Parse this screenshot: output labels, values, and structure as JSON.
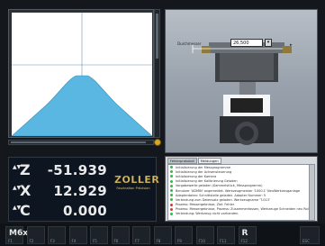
{
  "tool": {
    "label": "Durchmesser",
    "value": "26,500",
    "spin": "▾",
    "spin2": "▸"
  },
  "dro": {
    "axes": [
      {
        "arrows": "▲▼",
        "letter": "Z",
        "value": "-51.939"
      },
      {
        "arrows": "▲▼",
        "letter": "X",
        "value": "12.929"
      },
      {
        "arrows": "▲▼",
        "letter": "C",
        "value": "0.000"
      }
    ],
    "brand": {
      "name": "ZOLLER",
      "slogan": "Faszination Präzision"
    }
  },
  "messages": {
    "tabs": [
      "Fehlerprotokoll",
      "Meldungen"
    ],
    "items": [
      {
        "text": "Initialisierung der Messprogramme",
        "color": "#3bb54a"
      },
      {
        "text": "Initialisierung der Achsensteuerung",
        "color": "#3bb54a"
      },
      {
        "text": "Initialisierung der Kamera",
        "color": "#3bb54a"
      },
      {
        "text": "Initialisierung der Kalibrierung Geladen",
        "color": "#3bb54a"
      },
      {
        "text": "Vorgabewerte geladen (Sammelstück, Messprogramm)",
        "color": "#3bb54a"
      },
      {
        "text": "Benutzer 'ADMIN' angemeldet. Werkzeugmeister '1000.1' NeuWerkzeuganlage",
        "color": "#3bb54a"
      },
      {
        "text": "Adapterdaten: Schnittstelle geladen. Adapter Nummer: 5",
        "color": "#3bb54a"
      },
      {
        "text": "Verbindung zum Datensatz geladen. Werkzeugname 'T-013'",
        "color": "#3bb54a"
      },
      {
        "text": "Prozess: Messergebnisse, Ziel: Fehler",
        "color": "#d23b3b"
      },
      {
        "text": "Prozess: Messergebnisse, Prozess: Zusammenfassen, Werkzeuge Schneiden neu Rollen",
        "color": "#d23b3b"
      },
      {
        "text": "Verbindung: Werkzeug nicht vorhanden.",
        "color": "#3bb54a"
      }
    ]
  },
  "fkeys": [
    {
      "label": "F1",
      "icon": "M6x"
    },
    {
      "label": "F2",
      "icon": ""
    },
    {
      "label": "F3",
      "icon": ""
    },
    {
      "label": "F4",
      "icon": ""
    },
    {
      "label": "F5",
      "icon": ""
    },
    {
      "label": "F6",
      "icon": ""
    },
    {
      "label": "F7",
      "icon": ""
    },
    {
      "label": "F8",
      "icon": ""
    },
    {
      "label": "F9",
      "icon": ""
    },
    {
      "label": "F10",
      "icon": ""
    },
    {
      "label": "F11",
      "icon": ""
    },
    {
      "label": "F12",
      "icon": "R"
    },
    {
      "label": "ESC",
      "icon": ""
    }
  ]
}
